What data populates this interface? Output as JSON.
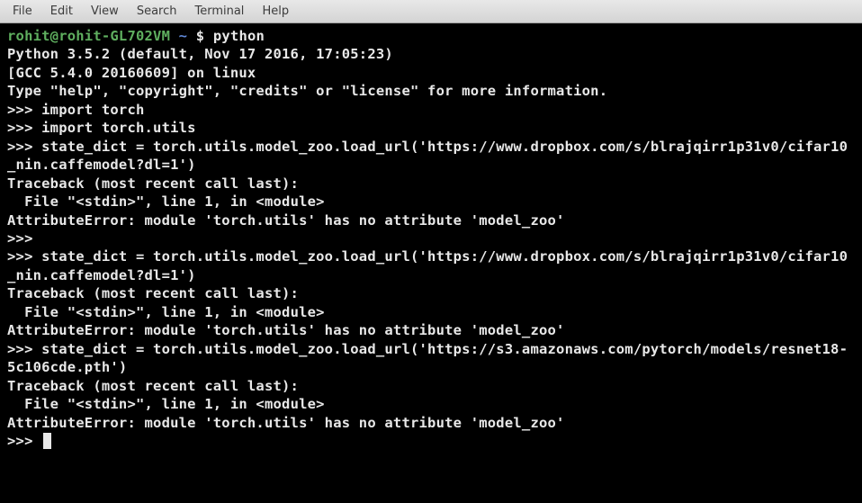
{
  "menubar": {
    "items": [
      "File",
      "Edit",
      "View",
      "Search",
      "Terminal",
      "Help"
    ]
  },
  "prompt": {
    "user_host": "rohit@rohit-GL702VM",
    "separator_colon": ":",
    "path": "~",
    "dollar": "$",
    "command": "python"
  },
  "terminal_lines": {
    "l0": "Python 3.5.2 (default, Nov 17 2016, 17:05:23)",
    "l1": "[GCC 5.4.0 20160609] on linux",
    "l2": "Type \"help\", \"copyright\", \"credits\" or \"license\" for more information.",
    "l3": ">>> import torch",
    "l4": ">>> import torch.utils",
    "l5": ">>> state_dict = torch.utils.model_zoo.load_url('https://www.dropbox.com/s/blrajqirr1p31v0/cifar10_nin.caffemodel?dl=1')",
    "l6": "Traceback (most recent call last):",
    "l7": "  File \"<stdin>\", line 1, in <module>",
    "l8": "AttributeError: module 'torch.utils' has no attribute 'model_zoo'",
    "l9": ">>>",
    "l10": ">>> state_dict = torch.utils.model_zoo.load_url('https://www.dropbox.com/s/blrajqirr1p31v0/cifar10_nin.caffemodel?dl=1')",
    "l11": "Traceback (most recent call last):",
    "l12": "  File \"<stdin>\", line 1, in <module>",
    "l13": "AttributeError: module 'torch.utils' has no attribute 'model_zoo'",
    "l14": ">>> state_dict = torch.utils.model_zoo.load_url('https://s3.amazonaws.com/pytorch/models/resnet18-5c106cde.pth')",
    "l15": "Traceback (most recent call last):",
    "l16": "  File \"<stdin>\", line 1, in <module>",
    "l17": "AttributeError: module 'torch.utils' has no attribute 'model_zoo'",
    "l18": ">>> "
  }
}
